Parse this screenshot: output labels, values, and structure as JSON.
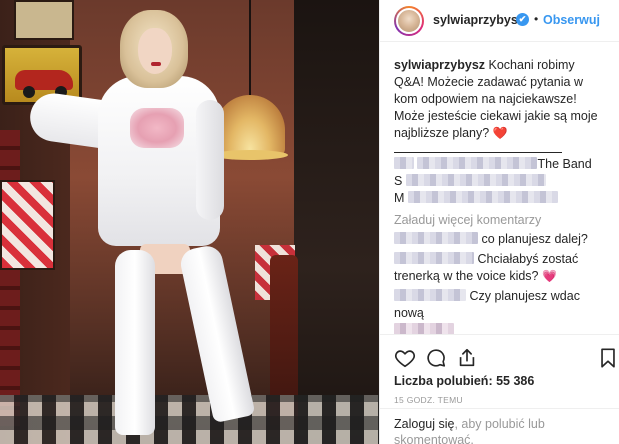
{
  "header": {
    "username": "sylwiaprzybysz",
    "verified_glyph": "✔",
    "separator": "•",
    "follow_label": "Obserwuj"
  },
  "caption": {
    "username": "sylwiaprzybysz",
    "text": "Kochani robimy Q&A! Możecie zadawać pytania w kom odpowiem na najciekawsze! Może jesteście ciekawi jakie są moje najbliższe plany?",
    "emoji": "❤️"
  },
  "comments": {
    "first_block": {
      "line1_visible": "The Band",
      "line2_visible": "S",
      "line3_visible": "M"
    },
    "load_more_label": "Załaduj więcej komentarzy",
    "items": [
      {
        "text": "co planujesz dalej?"
      },
      {
        "text": "Chciałabyś zostać trenerką w the voice kids?",
        "emoji": "💗"
      },
      {
        "text": "Czy planujesz wdac nową"
      },
      {
        "emoji": "💖"
      },
      {
        "emoji": "💕"
      },
      {
        "emoji": "❤️"
      }
    ]
  },
  "actions": {
    "like_icon": "heart-outline-icon",
    "comment_icon": "comment-bubble-icon",
    "share_icon": "share-icon",
    "save_icon": "bookmark-icon"
  },
  "likes": {
    "label": "Liczba polubień:",
    "count": "55 386"
  },
  "timestamp": "15 GODZ. TEMU",
  "login": {
    "link_text": "Zaloguj się",
    "rest_text": ", aby polubić lub skomentować."
  },
  "colors": {
    "accent": "#3897f0",
    "heart": "#ed4956",
    "muted": "#999999",
    "text": "#262626"
  }
}
